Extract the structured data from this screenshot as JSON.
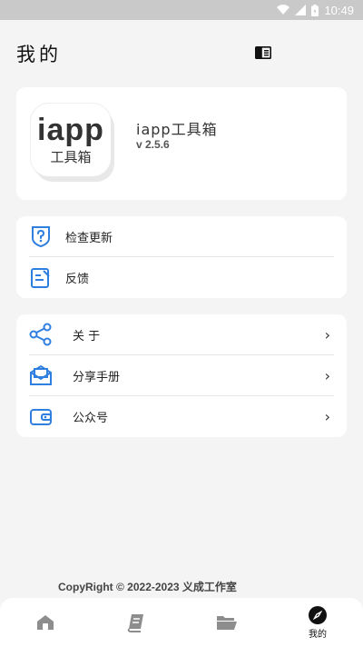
{
  "status": {
    "time": "10:49"
  },
  "header": {
    "title": "我的"
  },
  "app": {
    "icon_big": "iapp",
    "icon_small": "工具箱",
    "name": "iapp工具箱",
    "version": "v 2.5.6"
  },
  "menu1": [
    {
      "label": "检查更新",
      "icon": "shield-question-icon"
    },
    {
      "label": "反馈",
      "icon": "feedback-edit-icon"
    }
  ],
  "menu2": [
    {
      "label": "关 于",
      "icon": "share-nodes-icon"
    },
    {
      "label": "分享手册",
      "icon": "mail-open-icon"
    },
    {
      "label": "公众号",
      "icon": "wallet-icon"
    }
  ],
  "footer": {
    "copyright": "CopyRight © 2022-2023  义成工作室"
  },
  "nav": [
    {
      "label": "",
      "icon": "home-icon"
    },
    {
      "label": "",
      "icon": "book-icon"
    },
    {
      "label": "",
      "icon": "folder-icon"
    },
    {
      "label": "我的",
      "icon": "compass-icon"
    }
  ],
  "colors": {
    "accent": "#2f7fe0",
    "background": "#f4f4f4"
  }
}
